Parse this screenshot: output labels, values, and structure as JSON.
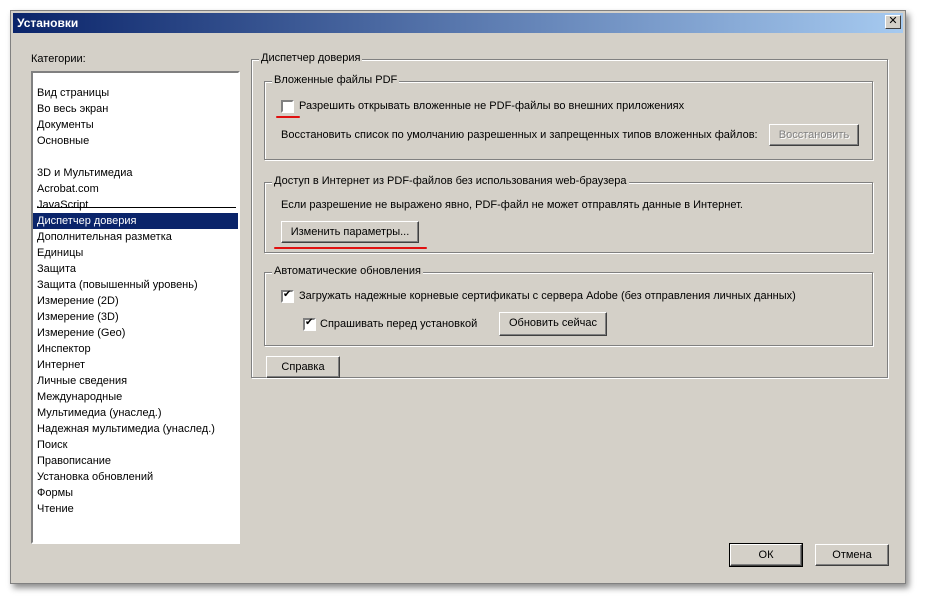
{
  "window": {
    "title": "Установки",
    "close_glyph": "✕"
  },
  "categories": {
    "label": "Категории:",
    "items_top": [
      "Вид страницы",
      "Во весь экран",
      "Документы",
      "Основные"
    ],
    "items_bottom": [
      "3D и Мультимедиа",
      "Acrobat.com",
      "JavaScript",
      "Диспетчер доверия",
      "Дополнительная разметка",
      "Единицы",
      "Защита",
      "Защита (повышенный уровень)",
      "Измерение (2D)",
      "Измерение (3D)",
      "Измерение (Geo)",
      "Инспектор",
      "Интернет",
      "Личные сведения",
      "Международные",
      "Мультимедиа (унаслед.)",
      "Надежная мультимедиа (унаслед.)",
      "Поиск",
      "Правописание",
      "Установка обновлений",
      "Формы",
      "Чтение"
    ],
    "selected": "Диспетчер доверия"
  },
  "trust_manager": {
    "title": "Диспетчер доверия",
    "pdf_attachments": {
      "title": "Вложенные файлы PDF",
      "allow_external_label": "Разрешить открывать вложенные не PDF-файлы во внешних приложениях",
      "allow_external_checked": false,
      "restore_text": "Восстановить список по умолчанию разрешенных и запрещенных типов вложенных файлов:",
      "restore_button": "Восстановить"
    },
    "internet_access": {
      "title": "Доступ в Интернет из PDF-файлов без использования web-браузера",
      "info_text": "Если разрешение не выражено явно, PDF-файл не может отправлять данные в Интернет.",
      "change_settings_button": "Изменить параметры..."
    },
    "auto_updates": {
      "title": "Автоматические обновления",
      "load_certs_label": "Загружать надежные корневые сертификаты с сервера Adobe (без отправления личных данных)",
      "load_certs_checked": true,
      "ask_before_label": "Спрашивать перед установкой",
      "ask_before_checked": true,
      "update_now_button": "Обновить сейчас"
    },
    "help_button": "Справка"
  },
  "footer": {
    "ok_button": "ОК",
    "cancel_button": "Отмена"
  },
  "accent_colors": {
    "selection": "#0a246a",
    "annotation_underline": "#e01010"
  },
  "check_glyph": "✔"
}
